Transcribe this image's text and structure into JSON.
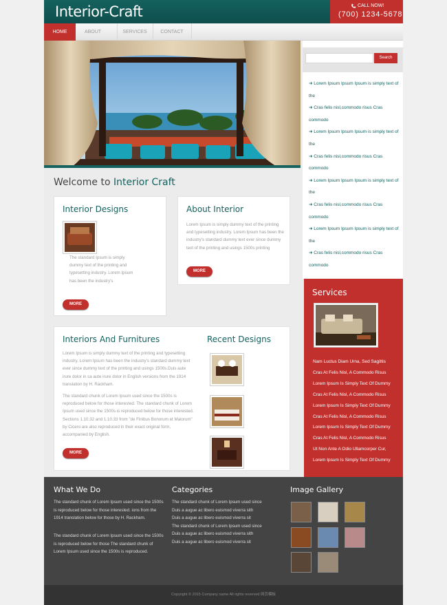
{
  "header": {
    "logo": "Interior-Craft",
    "call_label": "CALL NOW!",
    "phone": "(700) 1234-5678"
  },
  "nav": {
    "items": [
      "HOME",
      "ABOUT",
      "SERVICES",
      "CONTACT"
    ],
    "active": "HOME"
  },
  "welcome": {
    "prefix": "Welcome to",
    "brand": "Interior Craft"
  },
  "interior_designs": {
    "title": "Interior Designs",
    "text": "The standard Ipsum is simply dummy text of the printing and typesetting industry. Lorem Ipsum has been the industry's",
    "more": "MORE"
  },
  "about": {
    "title": "About Interior",
    "text": "Lorem Ipsum is simply dummy text of the printing and typesetting industry. Lorem Ipsum has been the industry's standard dummy text ever since dummy text of the printing and usings 1500s printing",
    "more": "MORE"
  },
  "furnitures": {
    "title": "Interiors And Furnitures",
    "p1": "Lorem Ipsum is simply dummy text of the printing and typesetting industry. Lorem Ipsum has been the industry's standard dummy text ever since dummy text of the printing and usings 1500s.Duis aute irure dolor in sa aute irure dolor in English versions from the 1914 translation by H. Rackham.",
    "p2": "The standard chunk of Lorem Ipsum used since the 1500s is reproduced below for those interested. The standard chunk of Lorem Ipsum used since the 1500s is reproduced below for those interested. Sections 1.10.32 and 1.10.33 from \"de Finibus Bonorum et Malorum\" by Cicero are also reproduced in their exact original form, accompanied by English.",
    "more": "MORE"
  },
  "recent": {
    "title": "Recent Designs"
  },
  "search": {
    "placeholder": "",
    "button": "Search"
  },
  "side_links": [
    "Lorem Ipsum Ipsum Ipsum is simply text of the",
    "Cras felis nisl,commodo risus Cras commodo",
    "Lorem Ipsum Ipsum Ipsum is simply text of the",
    "Cras felis nisl,commodo risus Cras commodo",
    "Lorem Ipsum Ipsum Ipsum is simply text of the",
    "Cras felis nisl,commodo risus Cras commodo",
    "Lorem Ipsum Ipsum Ipsum is simply text of the",
    "Cras felis nisl,commodo risus Cras commodo"
  ],
  "services": {
    "title": "Services",
    "items": [
      "Nam Luctus Diam Urna, Sed Sagittis",
      "Cras At Felis Nisl, A Commodo Risus",
      "Lorem Ipsum Is Simply Text Of Dummy",
      "Cras At Felis Nisl, A Commodo Risus",
      "Lorem Ipsum Is Simply Text Of Dummy",
      "Cras At Felis Nisl, A Commodo Risus",
      "Lorem Ipsum Is Simply Text Of Dummy",
      "Cras At Felis Nisl, A Commodo Risus",
      "Ut Non Ante A Odio Ullamcorper Cur,",
      "Lorem Ipsum Is Simply Text Of Dummy"
    ]
  },
  "footer": {
    "what_title": "What We Do",
    "what_p1": "The standard chunk of Lorem Ipsum used since the 1500s is reproduced below for those interested. ions from the 1914 translation below for those by H. Rackham.",
    "what_p2": "The standard chunk of Lorem Ipsum used since the 1500s is reproduced below for those The standard chunk of Lorem Ipsum used since the 1500s is reproduced.",
    "cat_title": "Categories",
    "cat_lines": [
      "The standard chunk of Lorem Ipsum used since",
      "Duis a augue ac libero euismod viverra sith",
      "Duis a augue ac libero euismod viverra sit",
      "The standard chunk of Lorem Ipsum used since",
      "Duis a augue ac libero euismod viverra sith",
      "Duis a augue ac libero euismod viverra sit"
    ],
    "gallery_title": "Image Gallery",
    "copyright": "Copyright © 2015 Company name All rights reserved 网页模板"
  }
}
